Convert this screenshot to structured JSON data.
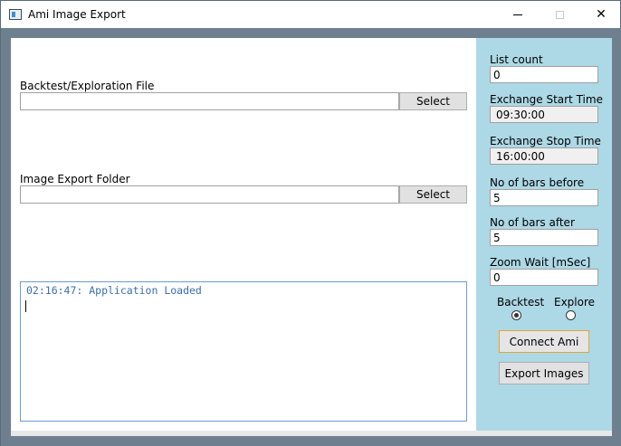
{
  "window": {
    "title": "Ami Image Export",
    "icon": "app-window-icon",
    "controls": {
      "minimize": "minimize-icon",
      "maximize": "maximize-icon",
      "close": "close-icon"
    }
  },
  "main": {
    "backtest_file": {
      "label": "Backtest/Exploration File",
      "value": "",
      "button_label": "Select"
    },
    "export_folder": {
      "label": "Image Export Folder",
      "value": "",
      "button_label": "Select"
    },
    "log": {
      "lines": [
        "02:16:47: Application Loaded"
      ]
    }
  },
  "sidebar": {
    "list_count": {
      "label": "List count",
      "value": "0"
    },
    "exchange_start": {
      "label": "Exchange Start Time",
      "value": "09:30:00"
    },
    "exchange_stop": {
      "label": "Exchange Stop Time",
      "value": "16:00:00"
    },
    "bars_before": {
      "label": "No of bars before",
      "value": "5"
    },
    "bars_after": {
      "label": "No of bars after",
      "value": "5"
    },
    "zoom_wait": {
      "label": "Zoom Wait [mSec]",
      "value": "0"
    },
    "mode": {
      "options": [
        {
          "label": "Backtest",
          "checked": true
        },
        {
          "label": "Explore",
          "checked": false
        }
      ]
    },
    "connect_button": "Connect Ami",
    "export_button": "Export Images"
  },
  "colors": {
    "sidebar_bg": "#add8e6",
    "frame_bg": "#6e7f8f",
    "log_text": "#3a6fb0",
    "default_button_border": "#e4a534"
  }
}
